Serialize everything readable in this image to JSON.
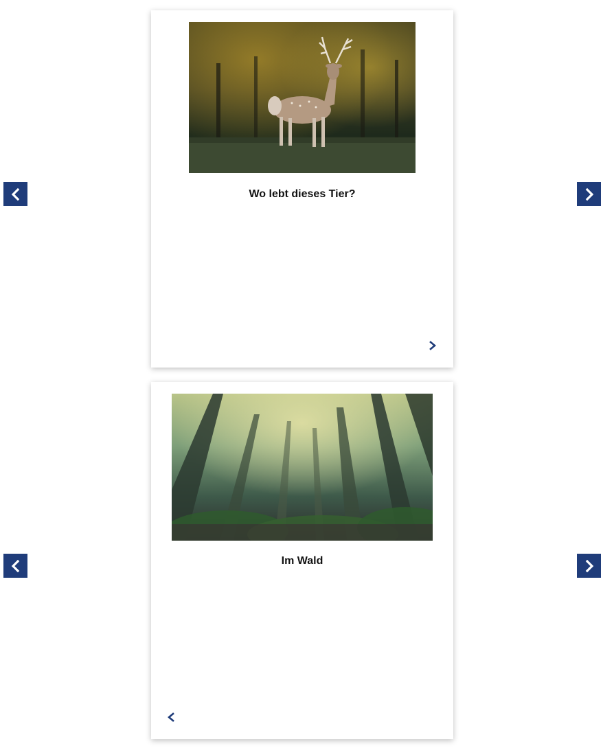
{
  "colors": {
    "accent": "#1f3c7a",
    "card_bg": "#ffffff",
    "caption_text": "#111111"
  },
  "slides": [
    {
      "image_icon": "deer-photo",
      "caption": "Wo lebt dieses Tier?",
      "inline_nav": "chevron-right-icon"
    },
    {
      "image_icon": "forest-photo",
      "caption": "Im Wald",
      "inline_nav": "chevron-left-icon"
    }
  ]
}
